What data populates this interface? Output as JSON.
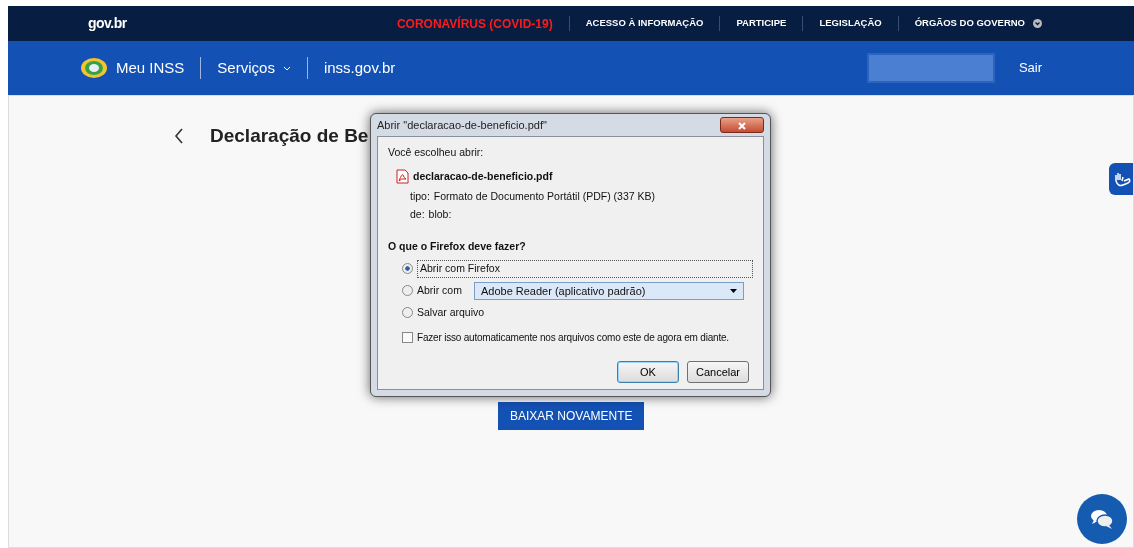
{
  "topbar": {
    "logo": "gov.br",
    "links": [
      {
        "label": "CORONAVÍRUS (COVID-19)",
        "kind": "alert"
      },
      {
        "label": "ACESSO À INFORMAÇÃO",
        "kind": "plain"
      },
      {
        "label": "PARTICIPE",
        "kind": "plain"
      },
      {
        "label": "LEGISLAÇÃO",
        "kind": "plain"
      },
      {
        "label": "ÓRGÃOS DO GOVERNO",
        "kind": "dropdown"
      }
    ]
  },
  "navbar": {
    "brand": "Meu INSS",
    "links": [
      {
        "label": "Serviços",
        "kind": "dropdown"
      },
      {
        "label": "inss.gov.br",
        "kind": "plain"
      }
    ],
    "logout": "Sair"
  },
  "page": {
    "title": "Declaração de Be",
    "button": "BAIXAR NOVAMENTE"
  },
  "dialog": {
    "title": "Abrir \"declaracao-de-beneficio.pdf\"",
    "intro": "Você escolheu abrir:",
    "file": "declaracao-de-beneficio.pdf",
    "details": [
      {
        "label": "tipo:",
        "value": "Formato de Documento Portátil (PDF) (337 KB)"
      },
      {
        "label": "de:",
        "value": "blob:"
      }
    ],
    "question": "O que o Firefox deve fazer?",
    "options": [
      {
        "label": "Abrir com Firefox",
        "selected": true,
        "kind": "plain"
      },
      {
        "label": "Abrir com",
        "selected": false,
        "kind": "app",
        "app": "Adobe Reader  (aplicativo padrão)"
      },
      {
        "label": "Salvar arquivo",
        "selected": false,
        "kind": "plain"
      }
    ],
    "remember": {
      "label": "Fazer isso automaticamente nos arquivos como este de agora em diante.",
      "checked": false
    },
    "buttons": [
      {
        "label": "OK",
        "kind": "default"
      },
      {
        "label": "Cancelar",
        "kind": "plain"
      }
    ]
  }
}
